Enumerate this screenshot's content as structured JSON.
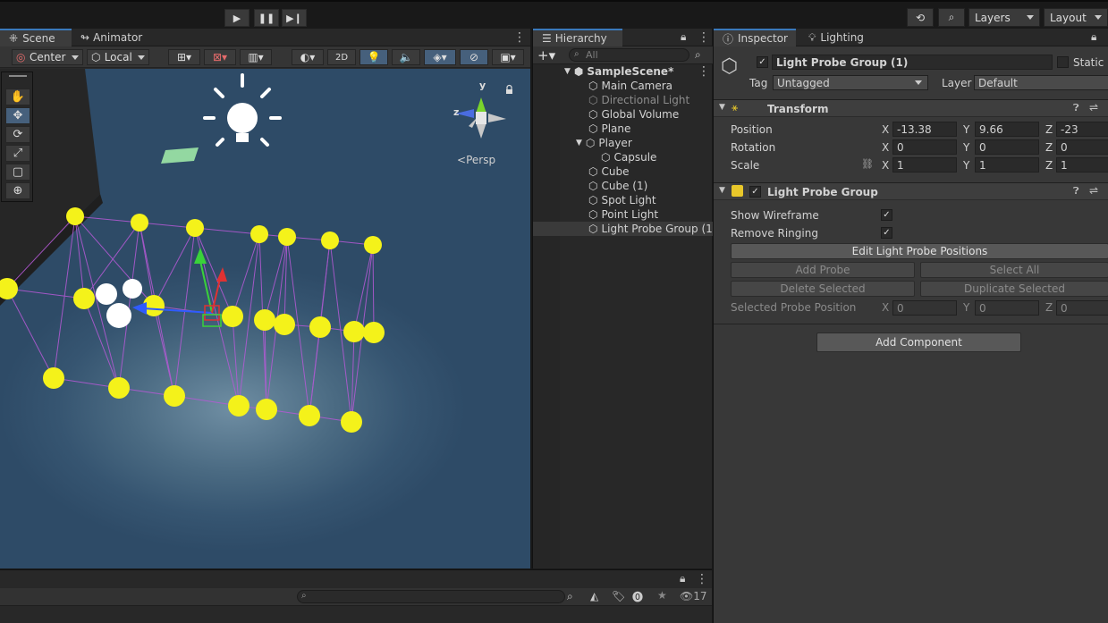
{
  "toolbar": {
    "play_icon": "play-icon",
    "pause_icon": "pause-icon",
    "step_icon": "step-icon",
    "history_icon": "history-icon",
    "search_icon": "search-icon",
    "layers_label": "Layers",
    "layout_label": "Layout"
  },
  "scene_panel": {
    "tabs": [
      {
        "label": "Scene"
      },
      {
        "label": "Animator"
      }
    ],
    "pivot_label": "Center",
    "space_label": "Local",
    "mode_2d": "2D",
    "persp_label": "Persp",
    "gizmo_axes": {
      "x": "x",
      "y": "y",
      "z": "z"
    }
  },
  "hierarchy": {
    "tab_label": "Hierarchy",
    "search_placeholder": "All",
    "scene_name": "SampleScene*",
    "items": [
      {
        "label": "Main Camera",
        "indent": 1,
        "dim": false,
        "arrow": false,
        "selected": false
      },
      {
        "label": "Directional Light",
        "indent": 1,
        "dim": true,
        "arrow": false,
        "selected": false
      },
      {
        "label": "Global Volume",
        "indent": 1,
        "dim": false,
        "arrow": false,
        "selected": false
      },
      {
        "label": "Plane",
        "indent": 1,
        "dim": false,
        "arrow": false,
        "selected": false
      },
      {
        "label": "Player",
        "indent": 1,
        "dim": false,
        "arrow": true,
        "selected": false
      },
      {
        "label": "Capsule",
        "indent": 2,
        "dim": false,
        "arrow": false,
        "selected": false
      },
      {
        "label": "Cube",
        "indent": 1,
        "dim": false,
        "arrow": false,
        "selected": false
      },
      {
        "label": "Cube (1)",
        "indent": 1,
        "dim": false,
        "arrow": false,
        "selected": false
      },
      {
        "label": "Spot Light",
        "indent": 1,
        "dim": false,
        "arrow": false,
        "selected": false
      },
      {
        "label": "Point Light",
        "indent": 1,
        "dim": false,
        "arrow": false,
        "selected": false
      },
      {
        "label": "Light Probe Group (1)",
        "indent": 1,
        "dim": false,
        "arrow": false,
        "selected": true
      }
    ]
  },
  "inspector": {
    "tabs": [
      {
        "label": "Inspector"
      },
      {
        "label": "Lighting"
      }
    ],
    "object_name": "Light Probe Group (1)",
    "static_label": "Static",
    "tag_label": "Tag",
    "tag_value": "Untagged",
    "layer_label": "Layer",
    "layer_value": "Default",
    "transform": {
      "title": "Transform",
      "position_label": "Position",
      "rotation_label": "Rotation",
      "scale_label": "Scale",
      "axis_x": "X",
      "axis_y": "Y",
      "axis_z": "Z",
      "position": {
        "x": "-13.38",
        "y": "9.66",
        "z": "-23"
      },
      "rotation": {
        "x": "0",
        "y": "0",
        "z": "0"
      },
      "scale": {
        "x": "1",
        "y": "1",
        "z": "1"
      }
    },
    "light_probe_group": {
      "title": "Light Probe Group",
      "show_wireframe_label": "Show Wireframe",
      "remove_ringing_label": "Remove Ringing",
      "check_mark": "✓",
      "edit_button": "Edit Light Probe Positions",
      "add_probe": "Add Probe",
      "select_all": "Select All",
      "delete_selected": "Delete Selected",
      "duplicate_selected": "Duplicate Selected",
      "selected_position_label": "Selected Probe Position",
      "selected_position": {
        "x": "0",
        "y": "0",
        "z": "0"
      }
    },
    "add_component": "Add Component"
  },
  "console": {
    "count_label": "17"
  },
  "colors": {
    "accent_blue": "#46607c",
    "probe_yellow": "#f4f21a",
    "wire_purple": "#b65ad6"
  }
}
